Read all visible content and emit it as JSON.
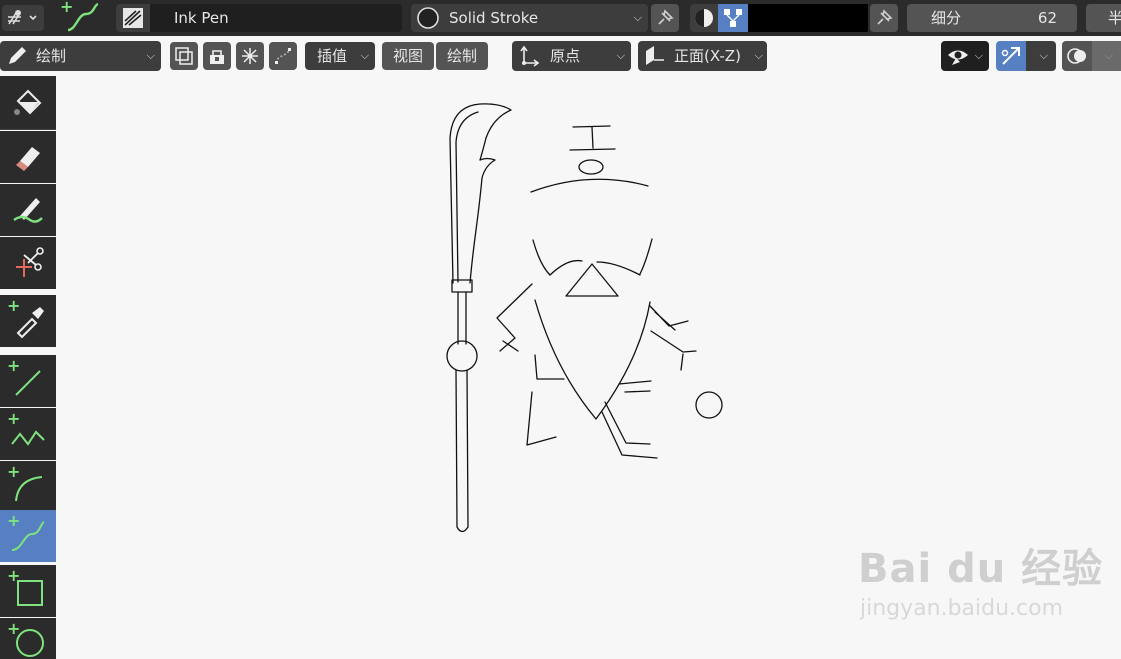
{
  "header": {
    "brush_name": "Ink Pen",
    "material_name": "Solid Stroke",
    "subdivide_label": "细分",
    "subdivide_value": "62",
    "cutoff_label": "半"
  },
  "toolbar": {
    "mode": "绘制",
    "interpolate": "插值",
    "view_tab": "视图",
    "draw_tab": "绘制",
    "origin": "原点",
    "orientation": "正面(X-Z)"
  },
  "colors": {
    "active_blue": "#5680c2",
    "header_bg": "#2b2b2b",
    "canvas_bg": "#f7f7f7",
    "plus_green": "#7ee27e"
  },
  "tools": [
    {
      "name": "fill-tool"
    },
    {
      "name": "erase-tool"
    },
    {
      "name": "tint-tool"
    },
    {
      "name": "cutter-tool"
    },
    {
      "name": "eyedropper-tool"
    },
    {
      "name": "line-tool"
    },
    {
      "name": "polyline-tool"
    },
    {
      "name": "arc-tool"
    },
    {
      "name": "curve-tool",
      "active": true
    },
    {
      "name": "box-tool"
    },
    {
      "name": "circle-tool"
    }
  ],
  "watermark": {
    "brand": "Bai du 经验",
    "url": "jingyan.baidu.com"
  }
}
